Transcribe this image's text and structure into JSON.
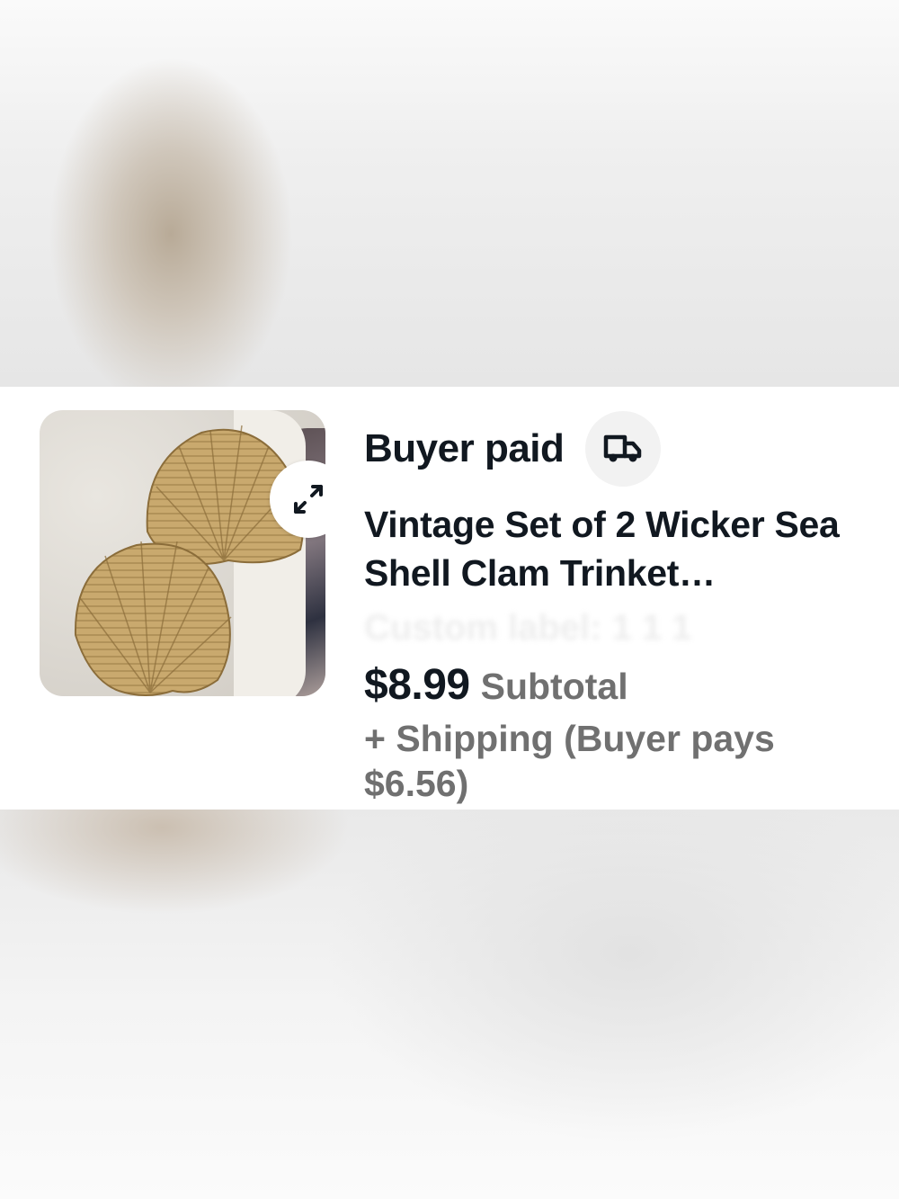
{
  "order_card": {
    "status": "Buyer paid",
    "title": "Vintage Set of 2 Wicker Sea Shell Clam Trinket…",
    "custom_label": "Custom label: 1 1 1",
    "price": "$8.99",
    "price_label": "Subtotal",
    "shipping_note": "+ Shipping (Buyer pays $6.56)",
    "icons": {
      "expand": "expand-arrows-icon",
      "shipping": "delivery-truck-icon"
    }
  },
  "colors": {
    "text_primary": "#111820",
    "text_secondary": "#707070",
    "card_background": "#ffffff",
    "shell": "#c9a96e"
  }
}
